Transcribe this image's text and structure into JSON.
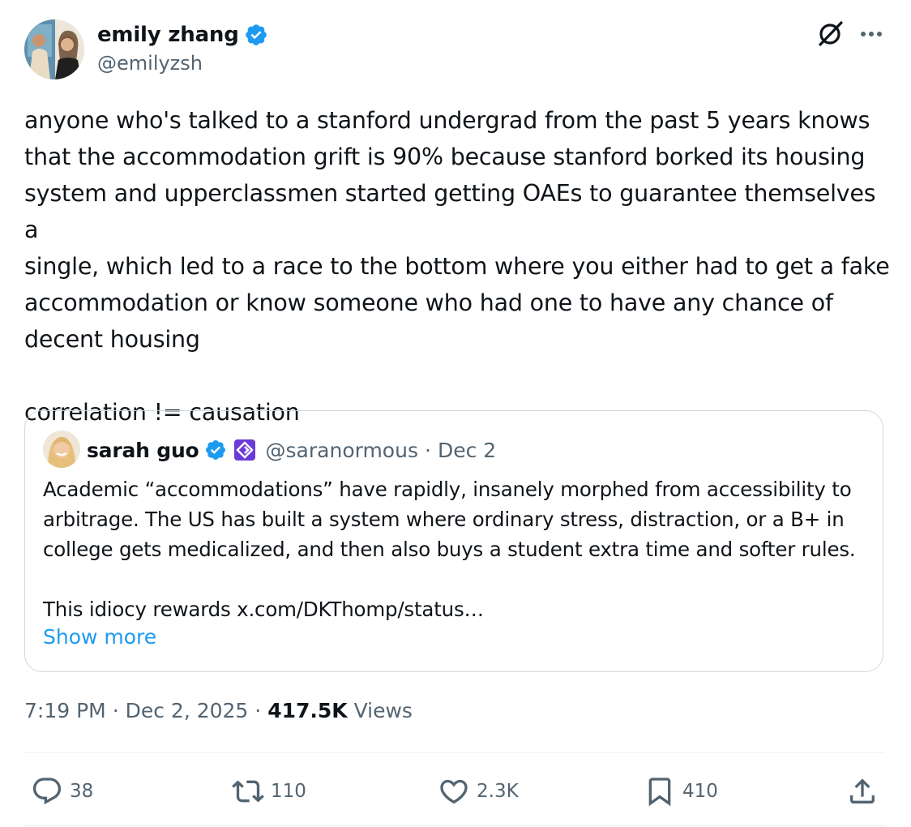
{
  "author": {
    "display_name": "emily zhang",
    "handle": "@emilyzsh"
  },
  "tweet": {
    "text": "anyone who's talked to a stanford undergrad from the past 5 years knows\nthat the accommodation grift is 90% because stanford borked its housing\nsystem and upperclassmen started getting OAEs to guarantee themselves a\nsingle, which led to a race to the bottom where you either had to get a fake\naccommodation or know someone who had one to have any chance of\ndecent housing\n\ncorrelation != causation"
  },
  "quote": {
    "display_name": "sarah guo",
    "handle": "@saranormous",
    "separator": "·",
    "date": "Dec 2",
    "text": "Academic “accommodations” have rapidly, insanely morphed from accessibility to\narbitrage. The US has built a system where ordinary stress, distraction, or a B+ in\ncollege gets medicalized, and then also buys a student extra time and softer rules.\n\nThis idiocy rewards x.com/DKThomp/status…",
    "show_more": "Show more"
  },
  "meta": {
    "time": "7:19 PM",
    "sep1": "·",
    "date": "Dec 2, 2025",
    "sep2": "·",
    "views_count": "417.5K",
    "views_label": "Views"
  },
  "actions": {
    "replies": "38",
    "reposts": "110",
    "likes": "2.3K",
    "bookmarks": "410"
  },
  "icons": {
    "verified": "verified-badge-icon",
    "affiliate": "affiliate-badge-icon",
    "grok": "grok-icon",
    "more": "more-icon",
    "reply": "reply-icon",
    "repost": "repost-icon",
    "like": "like-icon",
    "bookmark": "bookmark-icon",
    "share": "share-icon"
  },
  "colors": {
    "accent": "#1d9bf0",
    "text": "#0f1419",
    "secondary": "#536471",
    "border": "#cfd9de",
    "affiliate": "#6b3bd6"
  }
}
